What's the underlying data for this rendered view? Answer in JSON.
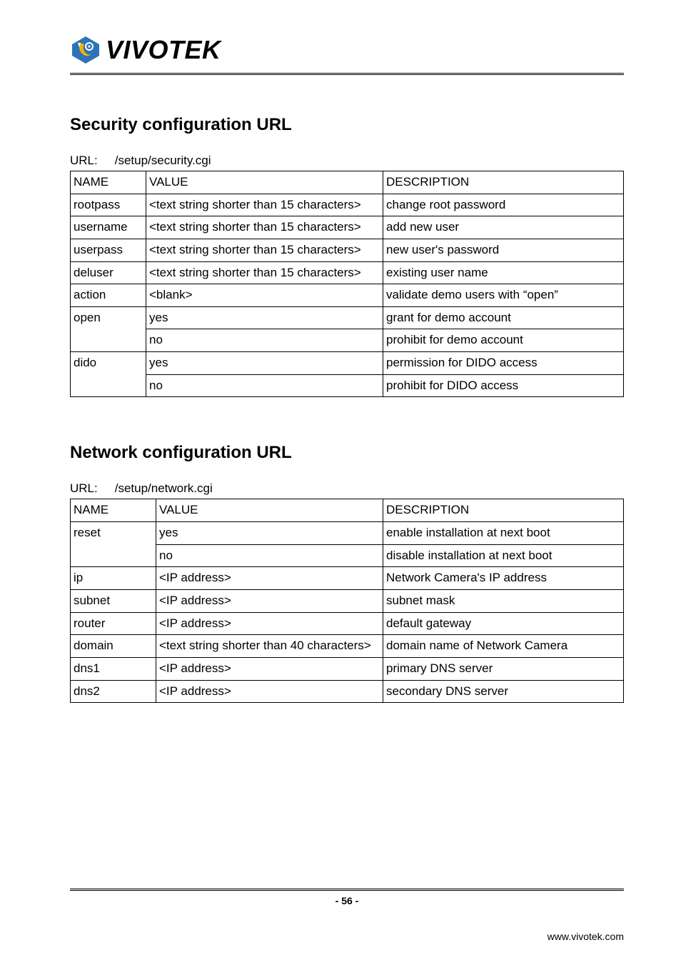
{
  "brand": {
    "name": "VIVOTEK"
  },
  "section1": {
    "title": "Security configuration URL",
    "url_label": "URL:",
    "url_value": "/setup/security.cgi",
    "cols": [
      "NAME",
      "VALUE",
      "DESCRIPTION"
    ],
    "rows": [
      {
        "name": "rootpass",
        "value": "<text string shorter than 15 characters>",
        "desc": "change root password"
      },
      {
        "name": "username",
        "value": "<text string shorter than 15 characters>",
        "desc": "add new user"
      },
      {
        "name": "userpass",
        "value": "<text string shorter than 15 characters>",
        "desc": "new user's password"
      },
      {
        "name": "deluser",
        "value": "<text string shorter than 15 characters>",
        "desc": "existing user name"
      },
      {
        "name": "action",
        "value": "<blank>",
        "desc": "validate demo users with “open”"
      },
      {
        "name": "open",
        "sub": [
          {
            "value": "yes",
            "desc": "grant for demo account"
          },
          {
            "value": "no",
            "desc": "prohibit for demo account"
          }
        ]
      },
      {
        "name": "dido",
        "sub": [
          {
            "value": "yes",
            "desc": "permission for DIDO access"
          },
          {
            "value": "no",
            "desc": "prohibit for DIDO access"
          }
        ]
      }
    ]
  },
  "section2": {
    "title": "Network configuration URL",
    "url_label": "URL:",
    "url_value": "/setup/network.cgi",
    "cols": [
      "NAME",
      "VALUE",
      "DESCRIPTION"
    ],
    "rows": [
      {
        "name": "reset",
        "sub": [
          {
            "value": "yes",
            "desc": "enable installation at next boot"
          },
          {
            "value": "no",
            "desc": "disable installation at next boot"
          }
        ]
      },
      {
        "name": "ip",
        "value": "<IP address>",
        "desc": "Network Camera's IP address"
      },
      {
        "name": "subnet",
        "value": "<IP address>",
        "desc": "subnet mask"
      },
      {
        "name": "router",
        "value": "<IP address>",
        "desc": "default gateway"
      },
      {
        "name": "domain",
        "value": "<text string shorter than 40 characters>",
        "desc": "domain name of Network Camera"
      },
      {
        "name": "dns1",
        "value": "<IP address>",
        "desc": "primary DNS server"
      },
      {
        "name": "dns2",
        "value": "<IP address>",
        "desc": "secondary DNS server"
      }
    ]
  },
  "footer": {
    "page": "- 56 -",
    "site": "www.vivotek.com"
  }
}
